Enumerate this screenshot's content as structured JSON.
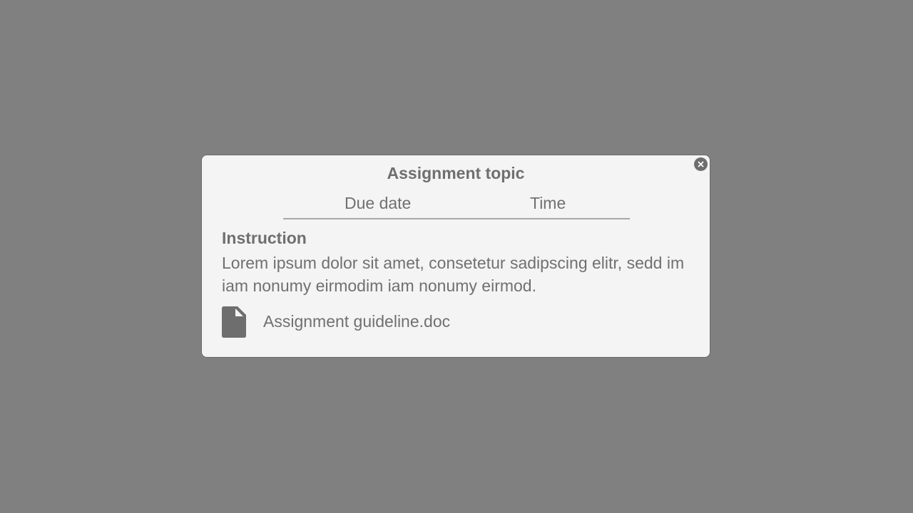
{
  "dialog": {
    "title": "Assignment topic",
    "due_date_label": "Due date",
    "time_label": "Time",
    "instruction_heading": "Instruction",
    "instruction_text": "Lorem ipsum dolor sit amet, consetetur sadipscing elitr, sedd im iam nonumy eirmodim iam nonumy eirmod.",
    "attachment": {
      "icon": "file-icon",
      "file_name": "Assignment guideline.doc"
    },
    "close_icon": "close-icon"
  },
  "colors": {
    "backdrop": "#808080",
    "dialog_bg": "#f4f4f4",
    "text": "#707070",
    "divider": "#a8a8a8",
    "icon": "#6e6e6e"
  }
}
